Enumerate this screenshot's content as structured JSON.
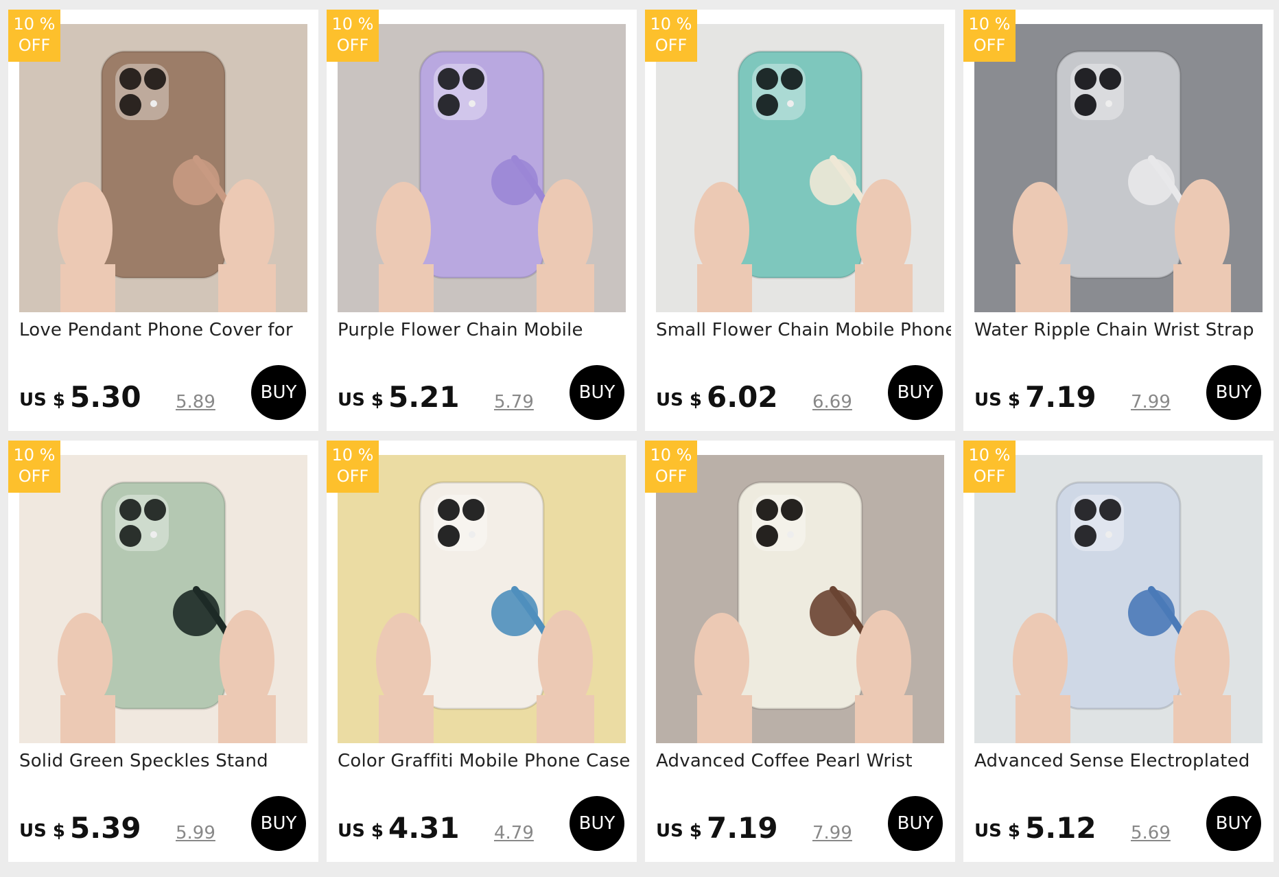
{
  "badge": {
    "line1": "10 %",
    "line2": "OFF"
  },
  "currency": "US $",
  "buy_label": "BUY",
  "products": [
    {
      "title": "Love Pendant Phone Cover for",
      "price": "5.30",
      "old_price": "5.89",
      "image": {
        "bg": "#d2c5b8",
        "case": "#9c7d68",
        "accent": "#c89a82",
        "cam": "#2b2420"
      }
    },
    {
      "title": "Purple Flower Chain Mobile",
      "price": "5.21",
      "old_price": "5.79",
      "image": {
        "bg": "#c9c3c0",
        "case": "#b9a8e0",
        "accent": "#9b86d6",
        "cam": "#2a2a30"
      }
    },
    {
      "title": "Small Flower Chain Mobile Phone",
      "price": "6.02",
      "old_price": "6.69",
      "image": {
        "bg": "#e5e5e3",
        "case": "#7ec7bd",
        "accent": "#efe8d6",
        "cam": "#1e2a2a"
      }
    },
    {
      "title": "Water Ripple Chain Wrist Strap",
      "price": "7.19",
      "old_price": "7.99",
      "image": {
        "bg": "#8a8c91",
        "case": "#c6c8cc",
        "accent": "#e8e8ea",
        "cam": "#222226"
      }
    },
    {
      "title": "Solid Green Speckles Stand",
      "price": "5.39",
      "old_price": "5.99",
      "image": {
        "bg": "#f0e8df",
        "case": "#b4c8b2",
        "accent": "#1d2a26",
        "cam": "#2a302c"
      }
    },
    {
      "title": "Color Graffiti Mobile Phone Case",
      "price": "4.31",
      "old_price": "4.79",
      "image": {
        "bg": "#ebdca3",
        "case": "#f3eee7",
        "accent": "#4f8fbd",
        "cam": "#262626"
      }
    },
    {
      "title": "Advanced Coffee Pearl Wrist",
      "price": "7.19",
      "old_price": "7.99",
      "image": {
        "bg": "#bab0a8",
        "case": "#eeebdf",
        "accent": "#6a4432",
        "cam": "#25221f"
      }
    },
    {
      "title": "Advanced Sense Electroplated",
      "price": "5.12",
      "old_price": "5.69",
      "image": {
        "bg": "#dfe3e4",
        "case": "#cfd8e6",
        "accent": "#4a7ab8",
        "cam": "#2a2a2e"
      }
    }
  ]
}
